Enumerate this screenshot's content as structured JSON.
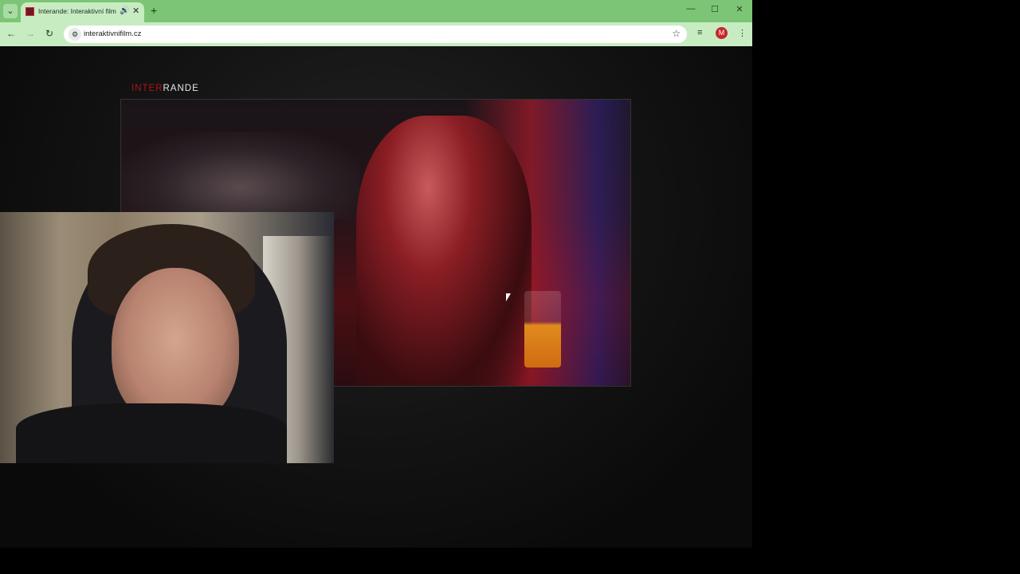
{
  "browser": {
    "tab": {
      "title": "Interande: Interaktivní film",
      "favicon": "interande-favicon",
      "audio_icon": "speaker-icon",
      "close_icon": "close-icon"
    },
    "new_tab_icon": "plus-icon",
    "tab_search_icon": "chevron-down-icon",
    "window_controls": {
      "minimize": "minimize-icon",
      "maximize": "maximize-icon",
      "close": "close-icon"
    },
    "toolbar": {
      "back_icon": "back-arrow-icon",
      "forward_icon": "forward-arrow-icon",
      "reload_icon": "reload-icon",
      "url": "interaktivnifilm.cz",
      "bookmark_icon": "star-icon",
      "media_icon": "media-control-icon",
      "profile_initial": "M",
      "menu_icon": "kebab-menu-icon"
    },
    "colors": {
      "frame": "#7cc576",
      "toolbar": "#c7ecc1",
      "profile": "#c8262c"
    }
  },
  "page": {
    "brand": {
      "part1": "INTER",
      "part2": "RANDE"
    },
    "brand_colors": {
      "accent": "#b2131a"
    },
    "video": {
      "scene": "woman at bar",
      "playing": true
    }
  },
  "webcam_overlay": {
    "visible": true
  }
}
